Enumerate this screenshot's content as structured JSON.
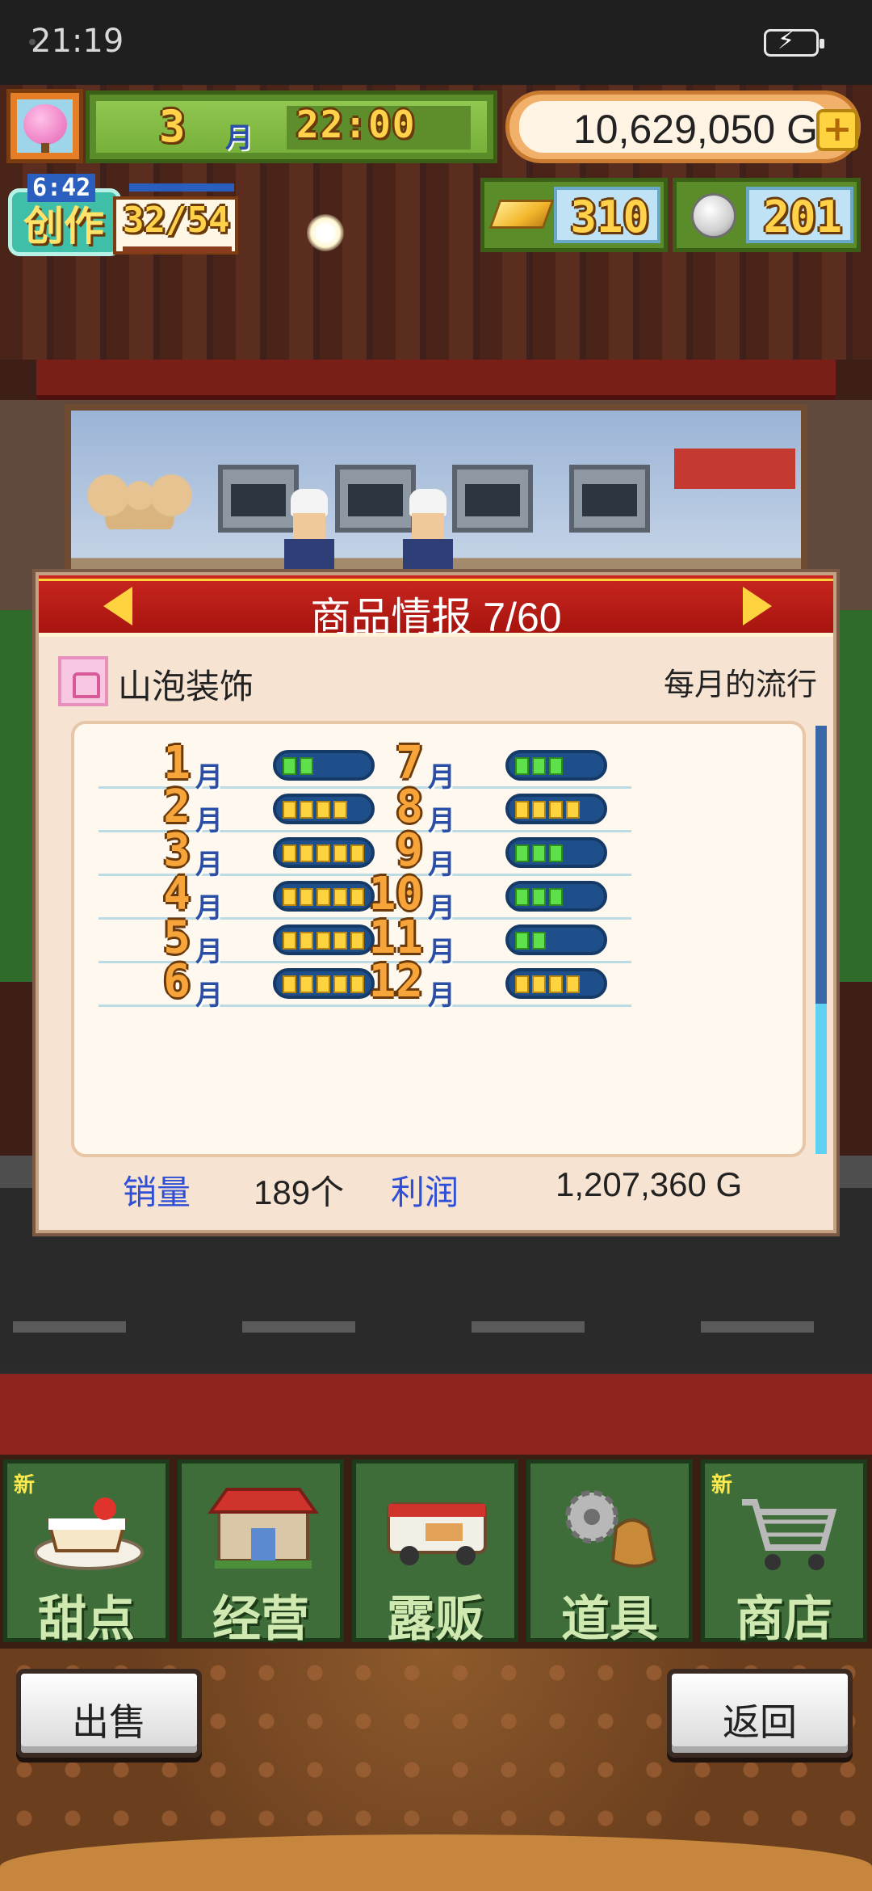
{
  "status_bar": {
    "time": "21:19"
  },
  "hud": {
    "month": "3",
    "month_unit": "月",
    "clock": "22:00",
    "money": "10,629,050 G",
    "money_plus": "+",
    "create_timer": "6:42",
    "create_label": "创作",
    "create_count": "32/54",
    "gold_count": "310",
    "silver_count": "201"
  },
  "panel": {
    "title": "商品情报 7/60",
    "item_name": "山泡装饰",
    "trend_label": "每月的流行",
    "months": [
      {
        "num": "1",
        "unit": "月",
        "level": 2,
        "color": "green"
      },
      {
        "num": "2",
        "unit": "月",
        "level": 4,
        "color": "yellow"
      },
      {
        "num": "3",
        "unit": "月",
        "level": 5,
        "color": "yellow"
      },
      {
        "num": "4",
        "unit": "月",
        "level": 5,
        "color": "yellow"
      },
      {
        "num": "5",
        "unit": "月",
        "level": 5,
        "color": "yellow"
      },
      {
        "num": "6",
        "unit": "月",
        "level": 5,
        "color": "yellow"
      },
      {
        "num": "7",
        "unit": "月",
        "level": 3,
        "color": "green"
      },
      {
        "num": "8",
        "unit": "月",
        "level": 4,
        "color": "yellow"
      },
      {
        "num": "9",
        "unit": "月",
        "level": 3,
        "color": "green"
      },
      {
        "num": "10",
        "unit": "月",
        "level": 3,
        "color": "green"
      },
      {
        "num": "11",
        "unit": "月",
        "level": 2,
        "color": "green"
      },
      {
        "num": "12",
        "unit": "月",
        "level": 4,
        "color": "yellow"
      }
    ],
    "sales_label": "销量",
    "sales_value": "189个",
    "profit_label": "利润",
    "profit_value": "1,207,360 G"
  },
  "menu": [
    {
      "label": "甜点",
      "new": "新",
      "icon": "cake-icon"
    },
    {
      "label": "经营",
      "new": "",
      "icon": "shop-icon"
    },
    {
      "label": "露贩",
      "new": "",
      "icon": "food-truck-icon"
    },
    {
      "label": "道具",
      "new": "",
      "icon": "gear-bag-icon"
    },
    {
      "label": "商店",
      "new": "新",
      "icon": "cart-icon"
    }
  ],
  "footer": {
    "sell": "出售",
    "back": "返回"
  },
  "colors": {
    "panel_header": "#c9271f",
    "trend_green": "#5ee04a",
    "trend_yellow": "#ffd23f",
    "label_blue": "#2f4fd6"
  }
}
